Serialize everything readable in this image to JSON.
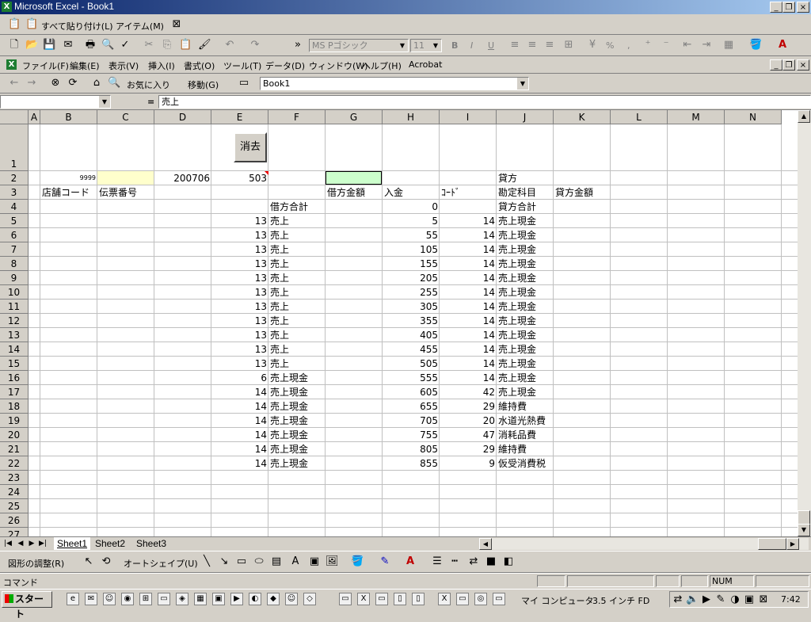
{
  "window": {
    "title": "Microsoft Excel - Book1"
  },
  "paste_bar": {
    "paste_all": "すべて貼り付け(L)",
    "item": "アイテム(M)"
  },
  "format_bar": {
    "font": "MS Pゴシック",
    "size": "11",
    "bold": "B",
    "italic": "I",
    "underline": "U",
    "percent": "%",
    "comma": ","
  },
  "menu": [
    "ファイル(F)",
    "編集(E)",
    "表示(V)",
    "挿入(I)",
    "書式(O)",
    "ツール(T)",
    "データ(D)",
    "ウィンドウ(W)",
    "ヘルプ(H)",
    "Acrobat"
  ],
  "web_bar": {
    "favorites": "お気に入り",
    "go": "移動(G)",
    "address": "Book1"
  },
  "formula_bar": {
    "name_box": "",
    "equals": "=",
    "content": "売上"
  },
  "columns": [
    "A",
    "B",
    "C",
    "D",
    "E",
    "F",
    "G",
    "H",
    "I",
    "J",
    "K",
    "L",
    "M",
    "N"
  ],
  "rows": [
    "1",
    "2",
    "3",
    "4",
    "5",
    "6",
    "7",
    "8",
    "9",
    "10",
    "11",
    "12",
    "13",
    "14",
    "15",
    "16",
    "17",
    "18",
    "19",
    "20",
    "21",
    "22",
    "23",
    "24",
    "25",
    "26",
    "27"
  ],
  "button_erase": "消去",
  "cells": {
    "B2": "9999",
    "D2": "200706",
    "E2": "503",
    "J2": "貸方",
    "B3": "店舗コード",
    "C3": "伝票番号",
    "G3": "借方金額",
    "H3": "入金",
    "I3": "ｺｰﾄﾞ",
    "J3": "勘定科目",
    "K3": "貸方金額",
    "F4": "借方合計",
    "H4": "0",
    "J4": "貸方合計"
  },
  "data_rows": [
    {
      "e": "13",
      "f": "売上",
      "h": "5",
      "i": "14",
      "j": "売上現金"
    },
    {
      "e": "13",
      "f": "売上",
      "h": "55",
      "i": "14",
      "j": "売上現金"
    },
    {
      "e": "13",
      "f": "売上",
      "h": "105",
      "i": "14",
      "j": "売上現金"
    },
    {
      "e": "13",
      "f": "売上",
      "h": "155",
      "i": "14",
      "j": "売上現金"
    },
    {
      "e": "13",
      "f": "売上",
      "h": "205",
      "i": "14",
      "j": "売上現金"
    },
    {
      "e": "13",
      "f": "売上",
      "h": "255",
      "i": "14",
      "j": "売上現金"
    },
    {
      "e": "13",
      "f": "売上",
      "h": "305",
      "i": "14",
      "j": "売上現金"
    },
    {
      "e": "13",
      "f": "売上",
      "h": "355",
      "i": "14",
      "j": "売上現金"
    },
    {
      "e": "13",
      "f": "売上",
      "h": "405",
      "i": "14",
      "j": "売上現金"
    },
    {
      "e": "13",
      "f": "売上",
      "h": "455",
      "i": "14",
      "j": "売上現金"
    },
    {
      "e": "13",
      "f": "売上",
      "h": "505",
      "i": "14",
      "j": "売上現金"
    },
    {
      "e": "6",
      "f": "売上現金",
      "h": "555",
      "i": "14",
      "j": "売上現金"
    },
    {
      "e": "14",
      "f": "売上現金",
      "h": "605",
      "i": "42",
      "j": "売上現金"
    },
    {
      "e": "14",
      "f": "売上現金",
      "h": "655",
      "i": "29",
      "j": "維持費"
    },
    {
      "e": "14",
      "f": "売上現金",
      "h": "705",
      "i": "20",
      "j": "水道光熱費"
    },
    {
      "e": "14",
      "f": "売上現金",
      "h": "755",
      "i": "47",
      "j": "消耗品費"
    },
    {
      "e": "14",
      "f": "売上現金",
      "h": "805",
      "i": "29",
      "j": "維持費"
    },
    {
      "e": "14",
      "f": "売上現金",
      "h": "855",
      "i": "9",
      "j": "仮受消費税"
    }
  ],
  "sheets": [
    "Sheet1",
    "Sheet2",
    "Sheet3"
  ],
  "drawing_bar": {
    "draw": "図形の調整(R)",
    "autoshape": "オートシェイプ(U)"
  },
  "status": {
    "mode": "コマンド",
    "num": "NUM"
  },
  "taskbar": {
    "start": "スタート",
    "my_computer": "マイ コンピュータ",
    "floppy": "3.5 インチ FD",
    "clock": "7:42"
  },
  "colors": {
    "yellow_cell": "#ffffcc",
    "green_cell": "#ccffcc",
    "title_start": "#0a246a"
  }
}
